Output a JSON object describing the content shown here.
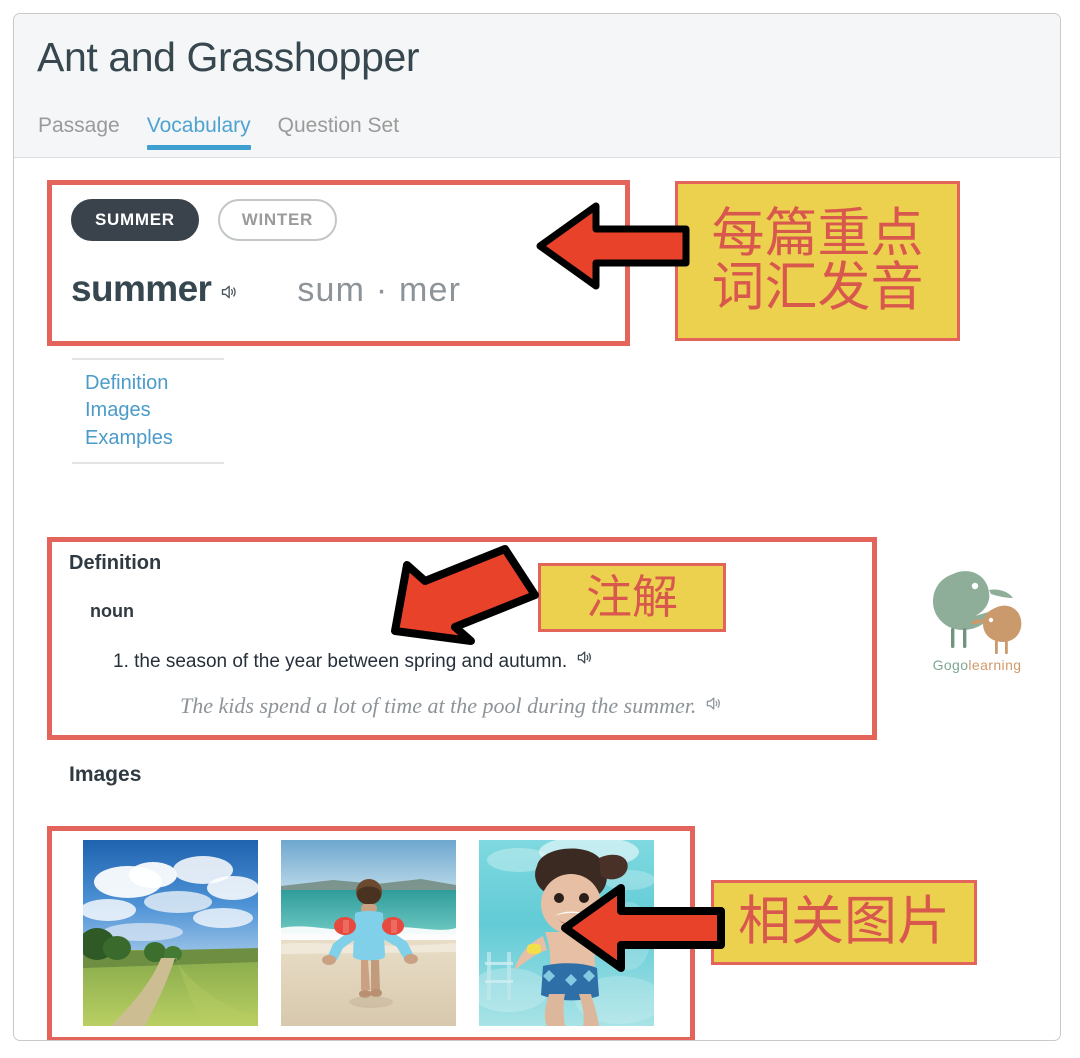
{
  "header": {
    "title": "Ant and Grasshopper",
    "tabs": [
      {
        "label": "Passage",
        "active": false
      },
      {
        "label": "Vocabulary",
        "active": true
      },
      {
        "label": "Question Set",
        "active": false
      }
    ]
  },
  "word_card": {
    "pills": [
      {
        "label": "SUMMER",
        "selected": true
      },
      {
        "label": "WINTER",
        "selected": false
      }
    ],
    "headword": "summer",
    "syllables": "sum · mer",
    "audio_icon": "speaker-icon"
  },
  "section_links": [
    {
      "label": "Definition"
    },
    {
      "label": "Images"
    },
    {
      "label": "Examples"
    }
  ],
  "definition": {
    "heading": "Definition",
    "part_of_speech": "noun",
    "sense_number": "1.",
    "sense_text": "the season of the year between spring and autumn.",
    "sense_full": "1. the season of the year between spring and autumn.",
    "example": "The kids spend a lot of time at the pool during the summer.",
    "audio_icon": "speaker-icon"
  },
  "images": {
    "heading": "Images",
    "thumbnails": [
      {
        "alt": "countryside path with green fields and clouds"
      },
      {
        "alt": "boy in blue swimsuit with red armbands on a beach"
      },
      {
        "alt": "child swimming underwater in a pool"
      }
    ]
  },
  "logo": {
    "text_first": "Gogo",
    "text_second": "learning",
    "icon": "two-birds-icon"
  },
  "annotations": [
    {
      "name": "annotation-vocabulary-audio",
      "line1": "每篇重点",
      "line2": "词汇发音"
    },
    {
      "name": "annotation-definition",
      "line1": "注解",
      "line2": ""
    },
    {
      "name": "annotation-images",
      "line1": "相关图片",
      "line2": ""
    }
  ],
  "colors": {
    "accent_blue": "#3e9fd0",
    "pill_dark": "#3a434c",
    "highlight_red": "#e2645a",
    "annotation_yellow": "#ecd14f",
    "arrow_red": "#e8422a",
    "link_blue": "#4a9bc9",
    "header_bg": "#f5f6f7"
  }
}
